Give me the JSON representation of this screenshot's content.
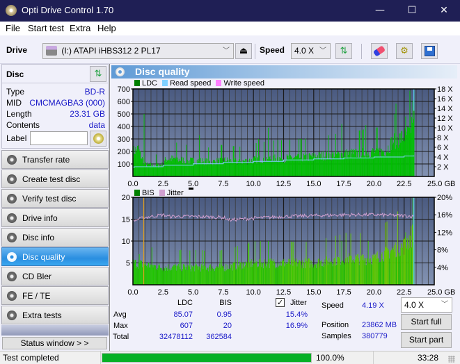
{
  "window": {
    "title": "Opti Drive Control 1.70",
    "minimize": "—",
    "maximize": "☐",
    "close": "✕"
  },
  "menu": [
    "File",
    "Start test",
    "Extra",
    "Help"
  ],
  "toolbar": {
    "drive_label": "Drive",
    "drive_value": "(I:)  ATAPI iHBS312   2 PL17",
    "speed_label": "Speed",
    "speed_value": "4.0 X",
    "chevron": "﹀"
  },
  "disc": {
    "header": "Disc",
    "rows": [
      {
        "label": "Type",
        "value": "BD-R"
      },
      {
        "label": "MID",
        "value": "CMCMAGBA3 (000)"
      },
      {
        "label": "Length",
        "value": "23.31 GB"
      },
      {
        "label": "Contents",
        "value": "data"
      }
    ],
    "label_field_label": "Label",
    "label_field_value": ""
  },
  "nav": [
    {
      "label": "Transfer rate",
      "active": false
    },
    {
      "label": "Create test disc",
      "active": false
    },
    {
      "label": "Verify test disc",
      "active": false
    },
    {
      "label": "Drive info",
      "active": false
    },
    {
      "label": "Disc info",
      "active": false
    },
    {
      "label": "Disc quality",
      "active": true
    },
    {
      "label": "CD Bler",
      "active": false
    },
    {
      "label": "FE / TE",
      "active": false
    },
    {
      "label": "Extra tests",
      "active": false
    }
  ],
  "status_window_button": "Status window > >",
  "panel_title": "Disc quality",
  "colors": {
    "ldc": "#00c000",
    "ldc_legend": "#008000",
    "read_speed": "#80d0ff",
    "write_speed": "#ff80ff",
    "bis": "#40c800",
    "jitter": "#d0a0d0",
    "plot_bg_top": "#4a5a80",
    "plot_bg_bottom": "#8090b0",
    "progress": "#06b025",
    "value_text": "#1a1ac8"
  },
  "chart_data": [
    {
      "type": "area",
      "title": "LDC / Read speed",
      "legend": [
        "LDC",
        "Read speed",
        "Write speed"
      ],
      "legend_position": "top-left",
      "xlabel": "GB",
      "xlim": [
        0,
        25
      ],
      "x_ticks": [
        "0.0",
        "2.5",
        "5.0",
        "7.5",
        "10.0",
        "12.5",
        "15.0",
        "17.5",
        "20.0",
        "22.5",
        "25.0 GB"
      ],
      "ylim_left": [
        0,
        700
      ],
      "y_ticks_left": [
        "100",
        "200",
        "300",
        "400",
        "500",
        "600",
        "700"
      ],
      "ylim_right": [
        0,
        18
      ],
      "y_ticks_right": [
        "2 X",
        "4 X",
        "6 X",
        "8 X",
        "10 X",
        "12 X",
        "14 X",
        "16 X",
        "18 X"
      ],
      "grid": true,
      "series": [
        {
          "name": "LDC",
          "x": [
            0,
            0.4,
            0.8,
            1.0,
            1.5,
            2.0,
            2.5,
            2.7,
            3.5,
            4.5,
            5.5,
            6.5,
            7.5,
            8.5,
            9.5,
            10.5,
            11.5,
            12.5,
            13.5,
            14.5,
            15.5,
            16.5,
            17.5,
            18.5,
            19.5,
            20.5,
            21.0,
            21.5,
            22.0,
            22.5,
            23.0,
            23.31
          ],
          "values": [
            200,
            220,
            130,
            95,
            90,
            90,
            95,
            140,
            140,
            125,
            125,
            115,
            130,
            120,
            125,
            140,
            145,
            145,
            150,
            155,
            165,
            170,
            180,
            185,
            195,
            200,
            210,
            280,
            300,
            320,
            350,
            600
          ],
          "peaks": [
            {
              "x": 0.9,
              "y": 500
            },
            {
              "x": 5.5,
              "y": 330
            },
            {
              "x": 10.4,
              "y": 300
            },
            {
              "x": 11.2,
              "y": 390
            },
            {
              "x": 12.0,
              "y": 290
            },
            {
              "x": 17.3,
              "y": 420
            },
            {
              "x": 19.3,
              "y": 410
            },
            {
              "x": 21.7,
              "y": 500
            },
            {
              "x": 22.6,
              "y": 480
            },
            {
              "x": 23.2,
              "y": 607
            }
          ]
        },
        {
          "name": "Read speed",
          "unit": "X",
          "x": [
            0.05,
            0.1,
            2.5,
            5.0,
            7.5,
            10.0,
            12.5,
            15.0,
            17.5,
            20.0,
            22.5,
            23.31
          ],
          "values": [
            1.8,
            2.0,
            2.3,
            2.6,
            2.9,
            3.1,
            3.4,
            3.6,
            3.8,
            4.0,
            4.2,
            4.3
          ]
        }
      ]
    },
    {
      "type": "bar",
      "title": "BIS / Jitter",
      "legend": [
        "BIS",
        "Jitter"
      ],
      "legend_position": "top-left",
      "xlabel": "GB",
      "xlim": [
        0,
        25
      ],
      "x_ticks": [
        "0.0",
        "2.5",
        "5.0",
        "7.5",
        "10.0",
        "12.5",
        "15.0",
        "17.5",
        "20.0",
        "22.5",
        "25.0 GB"
      ],
      "ylim_left": [
        0,
        20
      ],
      "y_ticks_left": [
        "5",
        "10",
        "15",
        "20"
      ],
      "ylim_right": [
        0,
        20
      ],
      "y_ticks_right": [
        "4%",
        "8%",
        "12%",
        "16%",
        "20%"
      ],
      "grid": true,
      "series": [
        {
          "name": "BIS",
          "x": [
            0,
            2.5,
            5.0,
            7.5,
            10.0,
            12.5,
            15.0,
            17.5,
            20.0,
            21.5,
            22.5,
            23.31
          ],
          "values": [
            5,
            4,
            4,
            4,
            5,
            5,
            5,
            6,
            6,
            8,
            9,
            12
          ],
          "peaks": [
            {
              "x": 0.5,
              "y": 7
            },
            {
              "x": 11.2,
              "y": 10
            },
            {
              "x": 17.3,
              "y": 10
            },
            {
              "x": 19.5,
              "y": 10
            },
            {
              "x": 22.6,
              "y": 12
            },
            {
              "x": 23.2,
              "y": 20
            }
          ]
        },
        {
          "name": "Jitter",
          "unit": "%",
          "x": [
            0,
            1.0,
            2.5,
            3.0,
            5.0,
            7.5,
            8.0,
            10.0,
            12.5,
            15.0,
            17.5,
            20.0,
            22.5,
            23.31
          ],
          "values": [
            14.6,
            15.4,
            16.0,
            15.6,
            15.6,
            15.4,
            14.8,
            15.2,
            15.6,
            15.8,
            16.0,
            16.0,
            15.8,
            15.6
          ]
        }
      ],
      "markers": [
        {
          "x": 0.9,
          "color": "#e0a020"
        },
        {
          "x": 23.31,
          "color": "#60d0ff"
        }
      ]
    }
  ],
  "stats": {
    "col_ldc": "LDC",
    "col_bis": "BIS",
    "jitter_label": "Jitter",
    "jitter_checked": true,
    "rows": [
      {
        "label": "Avg",
        "ldc": "85.07",
        "bis": "0.95",
        "jitter": "15.4%"
      },
      {
        "label": "Max",
        "ldc": "607",
        "bis": "20",
        "jitter": "16.9%"
      },
      {
        "label": "Total",
        "ldc": "32478112",
        "bis": "362584",
        "jitter": ""
      }
    ],
    "speed_label": "Speed",
    "speed_value": "4.19 X",
    "position_label": "Position",
    "position_value": "23862 MB",
    "samples_label": "Samples",
    "samples_value": "380779",
    "speed_select": "4.0 X",
    "start_full": "Start full",
    "start_part": "Start part"
  },
  "statusbar": {
    "text": "Test completed",
    "progress": 1.0,
    "progress_text": "100.0%",
    "time": "33:28"
  }
}
